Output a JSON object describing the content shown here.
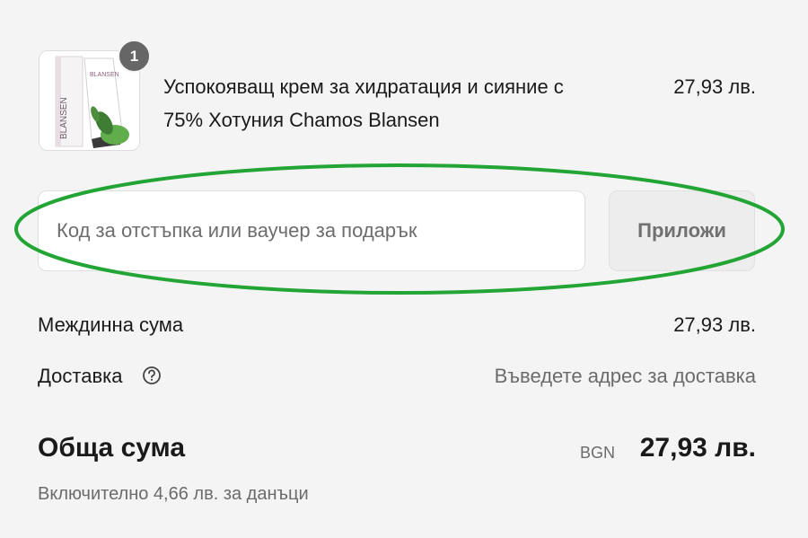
{
  "cart_item": {
    "quantity": "1",
    "name_line1": "Успокояващ крем за хидратация и сияние с",
    "name_line2": "75% Хотуния Chamos Blansen",
    "price": "27,93 лв.",
    "image_alt": "BLANSEN cream tube and box",
    "brand_text": "BLANSEN"
  },
  "discount": {
    "placeholder": "Код за отстъпка или ваучер за подарък",
    "value": "",
    "apply_label": "Приложи"
  },
  "summary": {
    "subtotal_label": "Междинна сума",
    "subtotal_value": "27,93 лв.",
    "shipping_label": "Доставка",
    "shipping_value": "Въведете адрес за доставка",
    "help_icon": "question-circle-icon"
  },
  "total": {
    "label": "Обща сума",
    "currency": "BGN",
    "value": "27,93 лв.",
    "tax_note": "Включително 4,66 лв. за данъци"
  },
  "colors": {
    "background": "#f4f4f4",
    "highlight": "#22a534",
    "badge": "#666666",
    "muted_text": "#6b6b6b"
  }
}
